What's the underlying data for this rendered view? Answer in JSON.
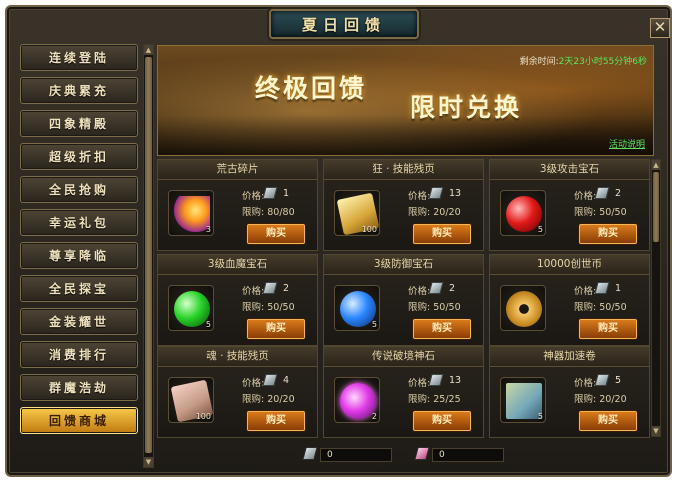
{
  "window": {
    "title": "夏日回馈",
    "close_label": "✕"
  },
  "sidebar": {
    "items": [
      {
        "label": "连续登陆"
      },
      {
        "label": "庆典累充"
      },
      {
        "label": "四象精殿"
      },
      {
        "label": "超级折扣"
      },
      {
        "label": "全民抢购"
      },
      {
        "label": "幸运礼包"
      },
      {
        "label": "尊享降临"
      },
      {
        "label": "全民探宝"
      },
      {
        "label": "金装耀世"
      },
      {
        "label": "消费排行"
      },
      {
        "label": "群魔浩劫"
      },
      {
        "label": "回馈商城"
      }
    ],
    "active_index": 11
  },
  "banner": {
    "headline_1": "终极回馈",
    "headline_2": "限时兑换",
    "timer_label": "剩余时间:",
    "timer_value": "2天23小时55分钟6秒",
    "rules_link": "活动说明"
  },
  "shop": {
    "price_label": "价格:",
    "limit_label": "限购:",
    "buy_label": "购买",
    "items": [
      {
        "name": "荒古碎片",
        "qty": "3",
        "price": "1",
        "limit": "80/80",
        "icon": "fire-shard-icon"
      },
      {
        "name": "狂 · 技能残页",
        "qty": "100",
        "price": "13",
        "limit": "20/20",
        "icon": "gold-scroll-icon"
      },
      {
        "name": "3级攻击宝石",
        "qty": "5",
        "price": "2",
        "limit": "50/50",
        "icon": "red-gem-icon"
      },
      {
        "name": "3级血魔宝石",
        "qty": "5",
        "price": "2",
        "limit": "50/50",
        "icon": "green-gem-icon"
      },
      {
        "name": "3级防御宝石",
        "qty": "5",
        "price": "2",
        "limit": "50/50",
        "icon": "blue-gem-icon"
      },
      {
        "name": "10000创世币",
        "qty": "",
        "price": "1",
        "limit": "50/50",
        "icon": "coins-icon"
      },
      {
        "name": "魂 · 技能残页",
        "qty": "100",
        "price": "4",
        "limit": "20/20",
        "icon": "pink-scroll-icon"
      },
      {
        "name": "传说破境神石",
        "qty": "2",
        "price": "13",
        "limit": "25/25",
        "icon": "purple-orb-icon"
      },
      {
        "name": "神器加速卷",
        "qty": "5",
        "price": "5",
        "limit": "20/20",
        "icon": "map-scroll-icon"
      }
    ]
  },
  "balance": {
    "silver_ticket": "0",
    "pink_ticket": "0"
  },
  "colors": {
    "accent_gold": "#f7c94a",
    "buy_button": "#d97a1b",
    "timer_green": "#5de35d"
  }
}
